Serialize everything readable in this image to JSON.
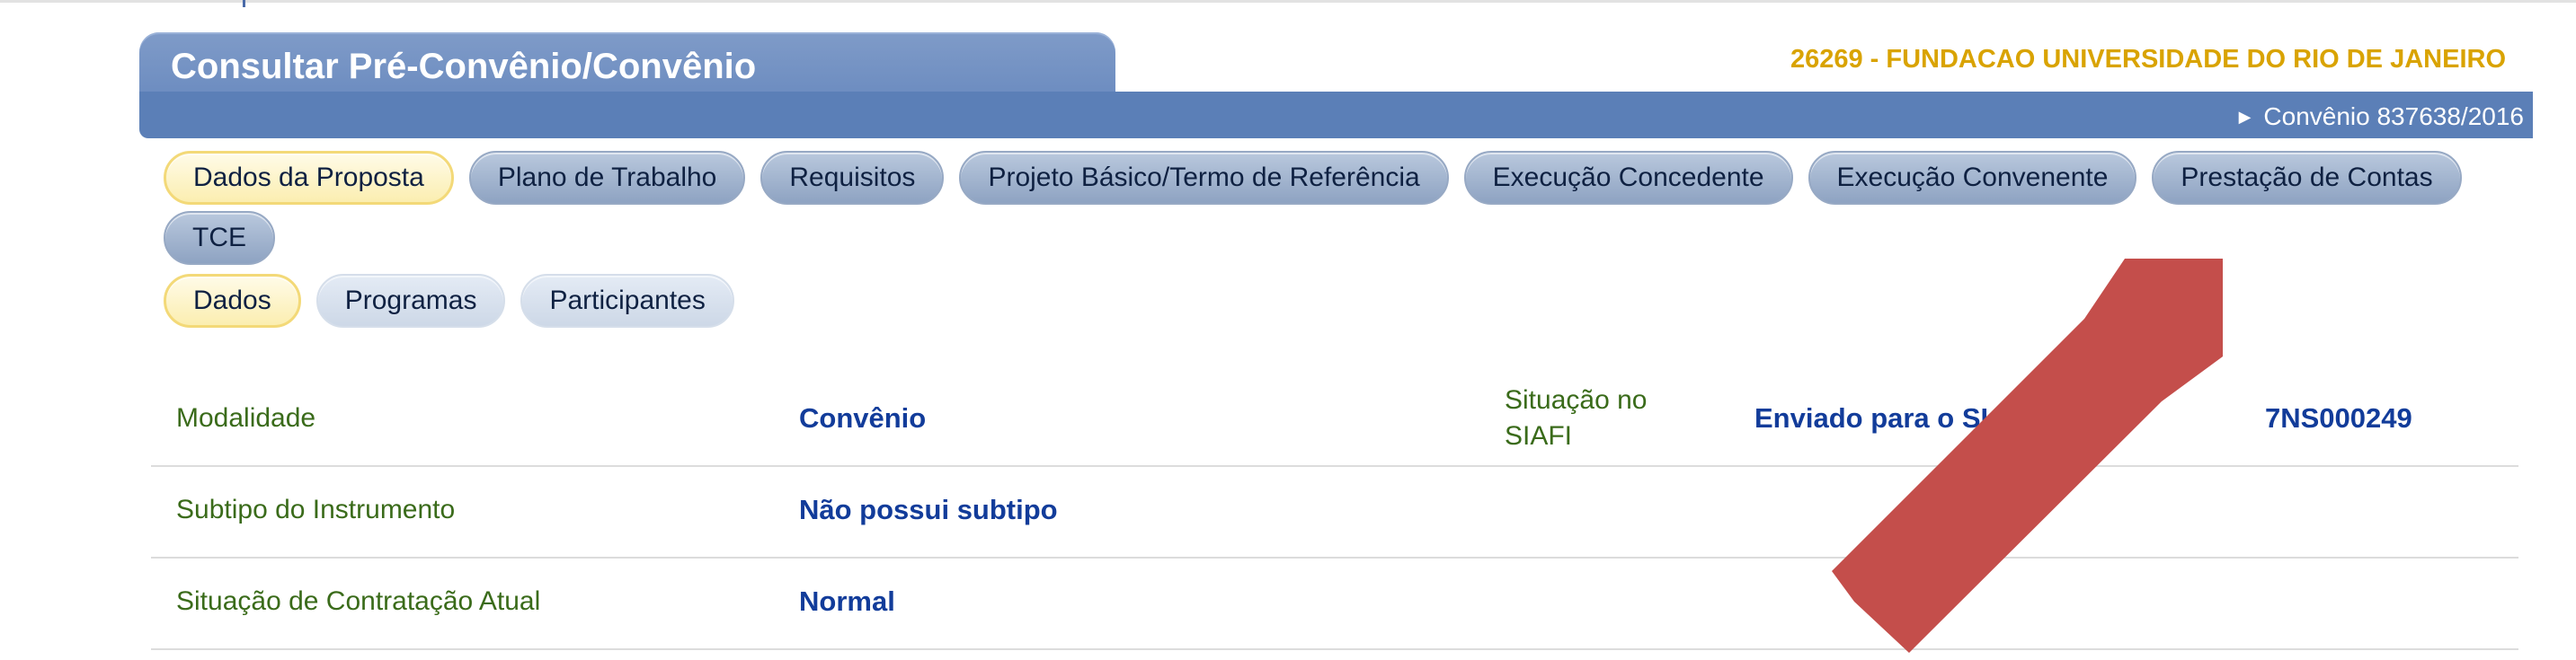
{
  "page": {
    "title": "Consultar Pré-Convênio/Convênio",
    "institution": "26269 - FUNDACAO UNIVERSIDADE DO RIO DE JANEIRO",
    "instrument": "Convênio 837638/2016"
  },
  "tabs": {
    "main": [
      {
        "label": "Dados da Proposta",
        "active": true
      },
      {
        "label": "Plano de Trabalho"
      },
      {
        "label": "Requisitos"
      },
      {
        "label": "Projeto Básico/Termo de Referência"
      },
      {
        "label": "Execução Concedente"
      },
      {
        "label": "Execução Convenente"
      },
      {
        "label": "Prestação de Contas"
      },
      {
        "label": "TCE"
      }
    ],
    "sub": [
      {
        "label": "Dados",
        "active": true
      },
      {
        "label": "Programas"
      },
      {
        "label": "Participantes"
      }
    ]
  },
  "details": {
    "modalidade_label": "Modalidade",
    "modalidade_value": "Convênio",
    "situacao_siafi_label_1": "Situação no",
    "situacao_siafi_label_2": "SIAFI",
    "situacao_siafi_value_a": "Enviado para o SIAF",
    "situacao_siafi_value_b": "7NS000249",
    "subtipo_label": "Subtipo do Instrumento",
    "subtipo_value": "Não possui subtipo",
    "contratacao_label": "Situação de Contratação Atual",
    "contratacao_value": "Normal"
  },
  "colors": {
    "header": "#5b7fb7",
    "institution_text": "#d9a300",
    "label_text": "#3a6b1a",
    "value_text": "#123c9a",
    "callout_arrow": "#c44e4b"
  },
  "annotation": {
    "icon": "red-arrow-pointing-up-right"
  }
}
